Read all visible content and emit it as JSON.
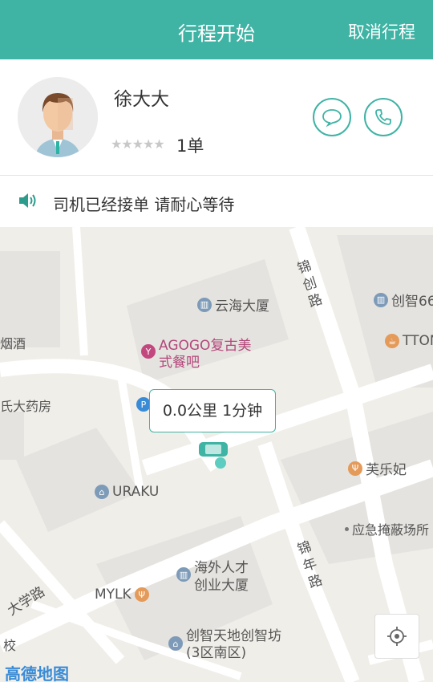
{
  "header": {
    "title": "行程开始",
    "cancel": "取消行程"
  },
  "driver": {
    "name": "徐大大",
    "stars": "★★★★★",
    "orders": "1单"
  },
  "status": {
    "message": "司机已经接单 请耐心等待"
  },
  "map": {
    "bubble": "0.0公里 1分钟",
    "logo": "高德地图",
    "labels": {
      "yanjiu": "烟酒",
      "pharmacy": "氏大药房",
      "yunhai": "云海大厦",
      "chuangzhi66": "创智66",
      "tton": "TTON",
      "agogo_line1": "AGOGO复古美",
      "agogo_line2": "式餐吧",
      "uraku": "URAKU",
      "meilefei": "芙乐妃",
      "shelter": "应急掩蔽场所",
      "haiwai_line1": "海外人才",
      "haiwai_line2": "创业大厦",
      "mylk": "MYLK",
      "chuangzhifang_line1": "创智天地创智坊",
      "chuangzhifang_line2": "(3区南区)",
      "school": "校",
      "road_jinchuang": "锦创路",
      "road_jinnian": "锦年路",
      "road_daxue": "大学路"
    }
  },
  "colors": {
    "accent": "#3fb3a4",
    "road": "#ffffff",
    "block": "#e5e3df",
    "poi_blue": "#7d9bb8",
    "poi_orange": "#e49a59",
    "poi_pink": "#c2477f"
  }
}
